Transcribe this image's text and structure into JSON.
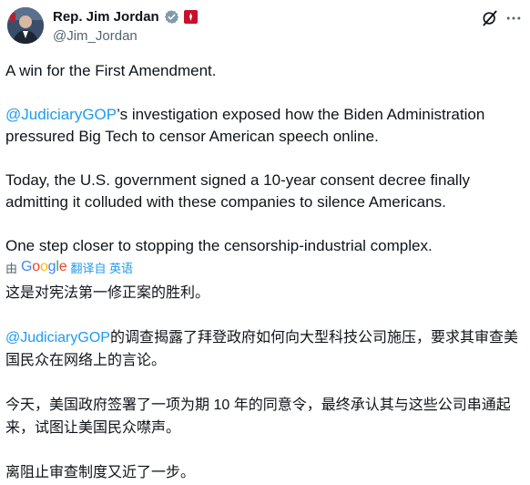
{
  "header": {
    "display_name": "Rep. Jim Jordan",
    "handle": "@Jim_Jordan"
  },
  "tweet": {
    "p1": "A win for the First Amendment.",
    "p2_mention": "@JudiciaryGOP",
    "p2_rest": "’s investigation exposed how the Biden Administration pressured Big Tech to censor American speech online.",
    "p3": "Today, the U.S. government signed a 10-year consent decree finally admitting it colluded with these companies to silence Americans.",
    "p4": "One step closer to stopping the censorship-industrial complex."
  },
  "translation_bar": {
    "by": "由",
    "google": [
      "G",
      "o",
      "o",
      "g",
      "l",
      "e"
    ],
    "link": "翻译自 英语"
  },
  "translated": {
    "c1": "这是对宪法第一修正案的胜利。",
    "c2_mention": "@JudiciaryGOP",
    "c2_rest": "的调查揭露了拜登政府如何向大型科技公司施压，要求其审查美国民众在网络上的言论。",
    "c3": "今天，美国政府签署了一项为期 10 年的同意令，最终承认其与这些公司串通起来，试图让美国民众噤声。",
    "c4": "离阻止审查制度又近了一步。"
  },
  "colors": {
    "text": "#0f1419",
    "secondary": "#536471",
    "link": "#1d9bf0",
    "verified": "#829aab",
    "affiliation": "#c8102e"
  },
  "icons": [
    "avatar",
    "verified-badge-icon",
    "affiliation-badge-icon",
    "grok-icon",
    "more-icon"
  ]
}
